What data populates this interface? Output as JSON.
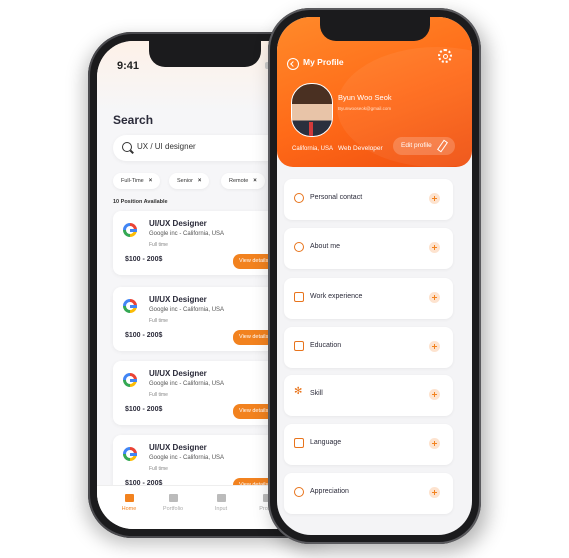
{
  "back_phone": {
    "status_time": "9:41",
    "search_title": "Search",
    "search_value": "UX / UI designer",
    "chips": [
      "Full-Time",
      "Senior",
      "Remote"
    ],
    "chip_close": "×",
    "available_count": "10 Position Available",
    "jobs": [
      {
        "title": "UI/UX Designer",
        "company": "Google inc - California, USA",
        "type": "Full time",
        "salary": "$100 - 200$",
        "button": "View details"
      },
      {
        "title": "UI/UX Designer",
        "company": "Google inc - California, USA",
        "type": "Full time",
        "salary": "$100 - 200$",
        "button": "View details"
      },
      {
        "title": "UI/UX Designer",
        "company": "Google inc - California, USA",
        "type": "Full time",
        "salary": "$100 - 200$",
        "button": "View details"
      },
      {
        "title": "UI/UX Designer",
        "company": "Google inc - California, USA",
        "type": "Full time",
        "salary": "$100 - 200$",
        "button": "View details"
      }
    ],
    "nav": [
      "Home",
      "Portfolio",
      "Input",
      "Profile"
    ],
    "accent_color": "#f2821f"
  },
  "front_phone": {
    "title": "My Profile",
    "user": {
      "name": "Byun Woo Seok",
      "email": "Byunwooseok@gmail.com",
      "location": "California, USA",
      "role": "Web Developer"
    },
    "edit_label": "Edit profile",
    "menu": [
      {
        "label": "Personal contact",
        "icon": "person-icon"
      },
      {
        "label": "About me",
        "icon": "user-icon"
      },
      {
        "label": "Work experience",
        "icon": "briefcase-icon"
      },
      {
        "label": "Education",
        "icon": "education-icon"
      },
      {
        "label": "Skill",
        "icon": "skill-icon"
      },
      {
        "label": "Language",
        "icon": "language-icon"
      },
      {
        "label": "Appreciation",
        "icon": "medal-icon"
      }
    ],
    "header_color": "#ff6a18"
  }
}
